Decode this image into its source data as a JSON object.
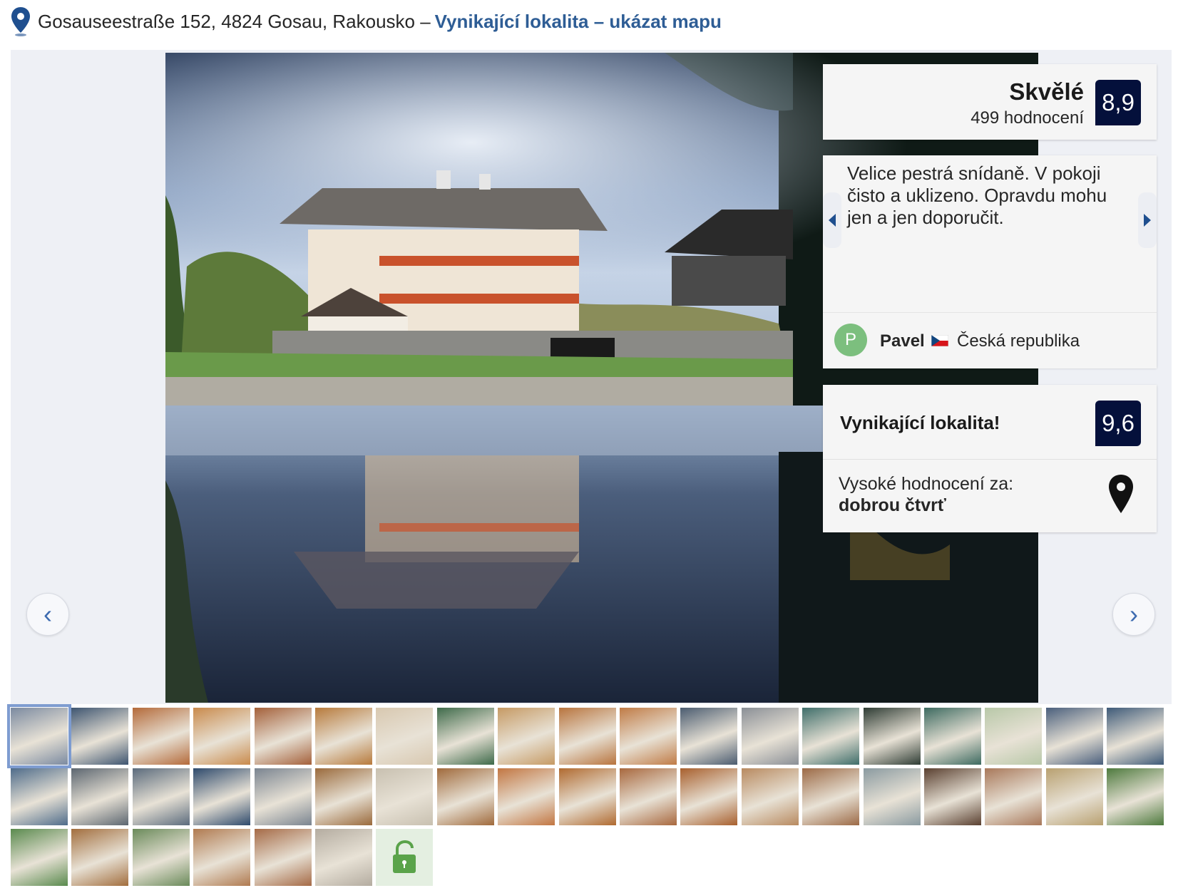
{
  "header": {
    "address": "Gosauseestraße 152, 4824 Gosau, Rakousko –",
    "map_link": "Vynikající lokalita – ukázat mapu",
    "pin_icon": "map-pin-icon"
  },
  "gallery": {
    "prev_label": "‹",
    "next_label": "›",
    "main_photo_icon": "hotel-lake-photo"
  },
  "rating": {
    "label": "Skvělé",
    "count": "499 hodnocení",
    "score": "8,9"
  },
  "review": {
    "text": "Velice pestrá snídaně. V pokoji čisto a uklizeno. Opravdu mohu jen a jen doporučit.",
    "prev_icon": "caret-left-icon",
    "next_icon": "caret-right-icon",
    "avatar_letter": "P",
    "reviewer_name": "Pavel",
    "reviewer_country": "Česká republika",
    "flag_icon": "czech-flag-icon"
  },
  "location": {
    "title": "Vynikající lokalita!",
    "score": "9,6",
    "subtitle": "Vysoké hodnocení za:",
    "subtitle_bold": "dobrou čtvrť",
    "pin_icon": "map-pin-icon"
  },
  "thumbnails": {
    "row1": [
      "#7b8aa0",
      "#3e5570",
      "#b46a3a",
      "#c98a4c",
      "#a4603a",
      "#b77a3c",
      "#d8c8b0",
      "#3e6a4a",
      "#c69a64",
      "#b8743e",
      "#c07b46",
      "#4b5c70",
      "#8a8f96",
      "#3f6e6a",
      "#2e3c34",
      "#3d6a60",
      "#b8c8a8",
      "#4a5f7c",
      "#3e5a78"
    ],
    "row2": [
      "#4f6c8a",
      "#5c6670",
      "#5b6b7c",
      "#2e4a6c",
      "#7a8490",
      "#9a6a3c",
      "#c8c0b0",
      "#a06a3c",
      "#c27642",
      "#b06a30",
      "#a8683e",
      "#a8602e",
      "#b88a60",
      "#9c6a46",
      "#8a9aa0",
      "#5a4030",
      "#a8785a",
      "#b8a070",
      "#4e7a3e"
    ],
    "row3": [
      "#5a8a4e",
      "#a26e3e",
      "#6a8a5a",
      "#b07a50",
      "#a56a46",
      "#b4aca0"
    ],
    "lock_icon": "lock-open-icon"
  }
}
